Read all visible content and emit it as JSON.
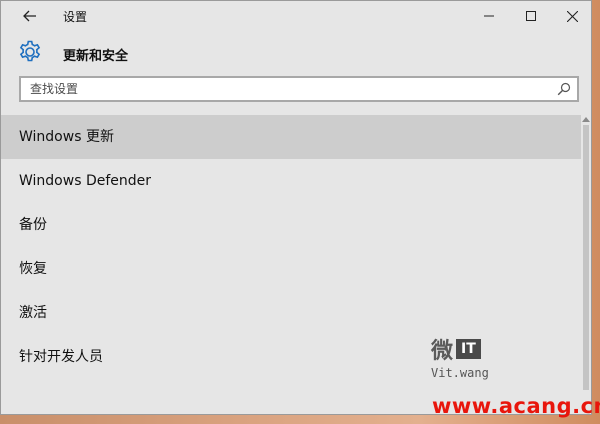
{
  "window": {
    "title": "设置",
    "controls": {
      "minimize_icon": "minimize-icon",
      "maximize_icon": "maximize-icon",
      "close_icon": "close-icon"
    },
    "back_icon": "back-arrow-icon"
  },
  "header": {
    "icon": "gear-icon",
    "title": "更新和安全",
    "accent": "#1f6fbf"
  },
  "search": {
    "placeholder": "查找设置",
    "value": "",
    "icon": "search-icon"
  },
  "nav": {
    "items": [
      {
        "label": "Windows 更新",
        "selected": true
      },
      {
        "label": "Windows Defender",
        "selected": false
      },
      {
        "label": "备份",
        "selected": false
      },
      {
        "label": "恢复",
        "selected": false
      },
      {
        "label": "激活",
        "selected": false
      },
      {
        "label": "针对开发人员",
        "selected": false
      }
    ]
  },
  "watermark": {
    "glyph": "微",
    "badge": "IT",
    "sub": "Vit.wang"
  },
  "site_watermark": {
    "text": "www.acang.cn",
    "color": "#e8160c"
  }
}
